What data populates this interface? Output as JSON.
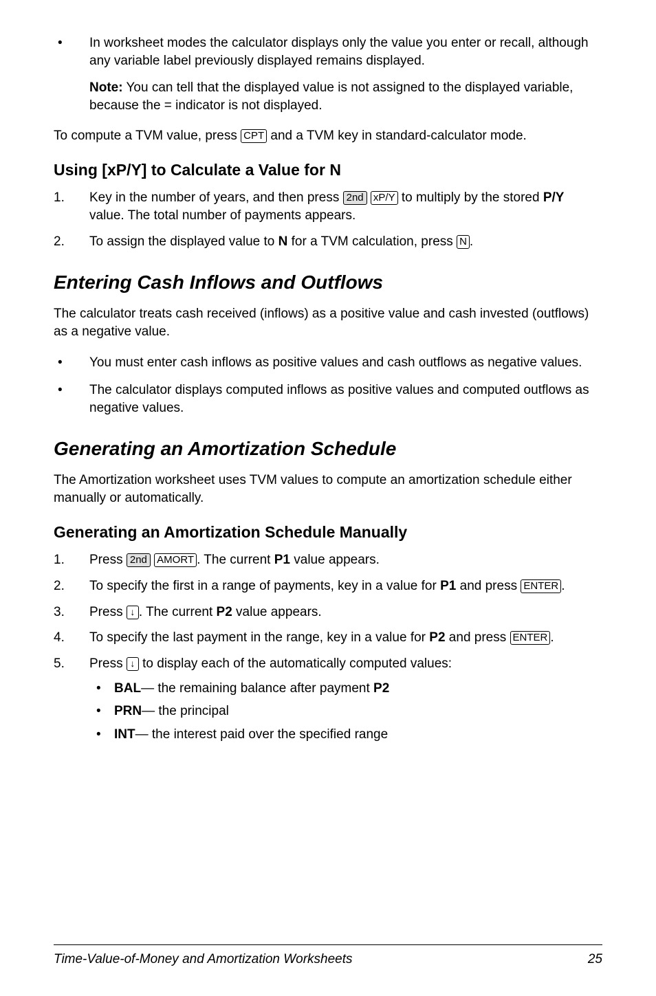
{
  "bullet1": {
    "text1": "In worksheet modes the calculator displays only the value you enter or recall, although any variable label previously displayed remains displayed.",
    "noteLabel": "Note:",
    "noteText": " You can tell that the displayed value is not assigned to the displayed variable, because the = indicator is not displayed."
  },
  "computePara": {
    "pre": "To compute a TVM value, press ",
    "key": "CPT",
    "post": " and a TVM key in standard-calculator mode."
  },
  "subhead1": "Using [xP/Y] to Calculate a Value for N",
  "list1": {
    "item1": {
      "num": "1.",
      "pre": "Key in the number of years, and then press ",
      "key1": "2nd",
      "key2": "xP/Y",
      "mid": " to multiply by the stored ",
      "bold": "P/Y",
      "post": " value. The total number of payments appears."
    },
    "item2": {
      "num": "2.",
      "pre": "To assign the displayed value to ",
      "bold": "N",
      "mid": " for a TVM calculation, press ",
      "key": "N",
      "post": "."
    }
  },
  "section1": "Entering Cash Inflows and Outflows",
  "section1para": "The calculator treats cash received (inflows) as a positive value and cash invested (outflows) as a negative value.",
  "section1bullets": {
    "b1": "You must enter cash inflows as positive values and cash outflows as negative values.",
    "b2": "The calculator displays computed inflows as positive values and computed outflows as negative values."
  },
  "section2": "Generating an Amortization Schedule",
  "section2para": "The Amortization worksheet uses TVM values to compute an amortization schedule either manually or automatically.",
  "subhead2": "Generating an Amortization Schedule Manually",
  "list2": {
    "item1": {
      "num": "1.",
      "pre": "Press ",
      "key1": "2nd",
      "key2": "AMORT",
      "mid": ". The current ",
      "bold": "P1",
      "post": " value appears."
    },
    "item2": {
      "num": "2.",
      "pre": "To specify the first in a range of payments, key in a value for ",
      "bold": "P1",
      "mid": " and press ",
      "key": "ENTER",
      "post": "."
    },
    "item3": {
      "num": "3.",
      "pre": "Press ",
      "key": "↓",
      "mid": ". The current ",
      "bold": "P2",
      "post": " value appears."
    },
    "item4": {
      "num": "4.",
      "pre": "To specify the last payment in the range, key in a value for ",
      "bold": "P2",
      "mid": " and press ",
      "key": "ENTER",
      "post": "."
    },
    "item5": {
      "num": "5.",
      "pre": "Press ",
      "key": "↓",
      "post": " to display each of the automatically computed values:",
      "sub1bold": "BAL",
      "sub1text": "— the remaining balance after payment ",
      "sub1bold2": "P2",
      "sub2bold": "PRN",
      "sub2text": "— the principal",
      "sub3bold": "INT",
      "sub3text": "— the interest paid over the specified range"
    }
  },
  "footer": {
    "title": "Time-Value-of-Money and Amortization Worksheets",
    "page": "25"
  }
}
